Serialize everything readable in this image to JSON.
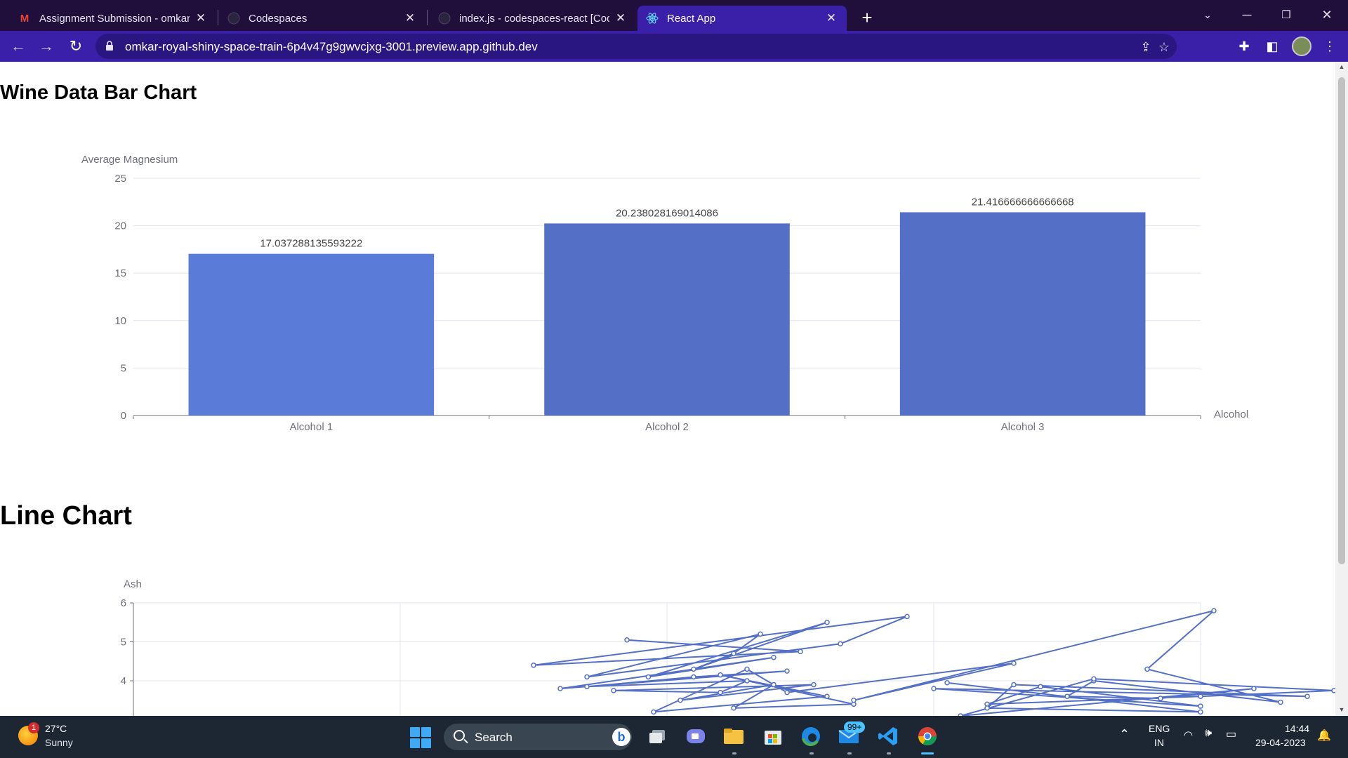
{
  "browser": {
    "tabs": [
      {
        "title": "Assignment Submission - omkar.r",
        "favicon": "gmail-icon",
        "active": false
      },
      {
        "title": "Codespaces",
        "favicon": "github-icon",
        "active": false
      },
      {
        "title": "index.js - codespaces-react [Codespaces]",
        "favicon": "github-icon",
        "active": false
      },
      {
        "title": "React App",
        "favicon": "react-icon",
        "active": true
      }
    ],
    "url": "omkar-royal-shiny-space-train-6p4v47g9gwvcjxg-3001.preview.app.github.dev",
    "tab_close": "✕",
    "new_tab": "+"
  },
  "page": {
    "bar_title": "Wine Data Bar Chart",
    "line_title": "Line Chart"
  },
  "chart_data": [
    {
      "type": "bar",
      "ylabel": "Average Magnesium",
      "xlabel": "Alcohol",
      "categories": [
        "Alcohol 1",
        "Alcohol 2",
        "Alcohol 3"
      ],
      "values": [
        17.037288135593222,
        20.238028169014086,
        21.416666666666668
      ],
      "value_labels": [
        "17.037288135593222",
        "20.238028169014086",
        "21.416666666666668"
      ],
      "ylim": [
        0,
        25
      ],
      "yticks": [
        0,
        5,
        10,
        15,
        20,
        25
      ],
      "colors": [
        "#5b7bd9",
        "#5470c6",
        "#5470c6"
      ],
      "grid": true
    },
    {
      "type": "line",
      "ylabel": "Ash",
      "ylim": [
        3,
        6
      ],
      "yticks": [
        4,
        5,
        6
      ],
      "xlim": [
        11,
        15
      ],
      "color": "#5470c6",
      "grid": true,
      "x": [
        12.85,
        13.5,
        12.5,
        13.9,
        13.65,
        12.7,
        13.35,
        13.25,
        13.1,
        13.6,
        12.93,
        13.4,
        12.6,
        13.45,
        13.1,
        12.7,
        13.3,
        13.2,
        12.8,
        13.55,
        13.05,
        13.4,
        13.25,
        13.7,
        13.2,
        13.6,
        12.95,
        13.3,
        13.45,
        14.3,
        13.7,
        15.05,
        14.8,
        15.3,
        14.6,
        14.5,
        14.85,
        15.2,
        14.1,
        14.6,
        15.5,
        15.0,
        14.2,
        14.4,
        15.0,
        14.0,
        15.4,
        14.3,
        14.2,
        15.0,
        14.05
      ],
      "y": [
        5.05,
        4.75,
        4.4,
        5.65,
        4.95,
        4.1,
        5.2,
        4.7,
        4.3,
        5.5,
        4.1,
        4.6,
        3.8,
        4.25,
        4.1,
        3.85,
        4.0,
        3.7,
        3.75,
        3.9,
        3.5,
        3.9,
        3.3,
        3.4,
        4.15,
        3.6,
        3.2,
        4.3,
        3.7,
        4.45,
        3.5,
        5.8,
        4.3,
        3.45,
        4.0,
        3.6,
        3.55,
        3.8,
        3.1,
        4.05,
        3.75,
        3.6,
        3.4,
        3.85,
        3.35,
        3.8,
        3.6,
        3.9,
        3.3,
        3.2,
        3.95
      ]
    }
  ],
  "taskbar": {
    "weather_temp": "27°C",
    "weather_desc": "Sunny",
    "weather_badge": "1",
    "search_label": "Search",
    "mail_badge": "99+",
    "lang": "ENG",
    "region": "IN",
    "time": "14:44",
    "date": "29-04-2023"
  }
}
